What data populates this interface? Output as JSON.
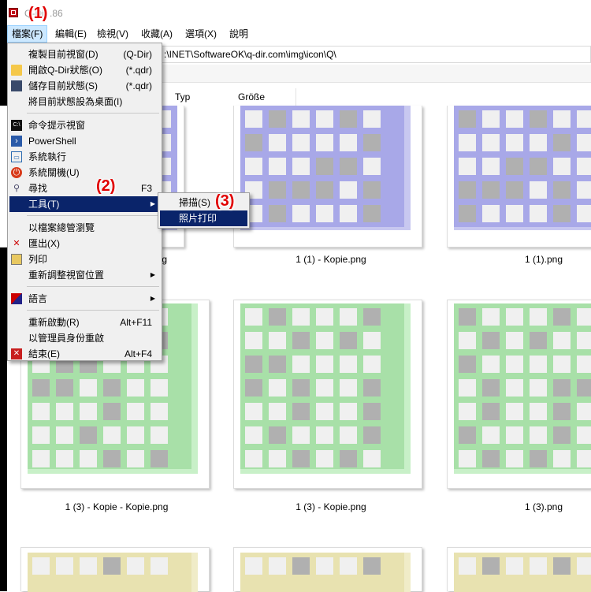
{
  "window": {
    "title_visible": "Q-Dir .86"
  },
  "menubar": [
    {
      "label": "檔案(F)"
    },
    {
      "label": "編輯(E)"
    },
    {
      "label": "檢視(V)"
    },
    {
      "label": "收藏(A)"
    },
    {
      "label": "選項(X)"
    },
    {
      "label": "說明"
    }
  ],
  "address": {
    "value": ":\\INET\\SoftwareOK\\q-dir.com\\img\\icon\\Q\\"
  },
  "columns": [
    "Typ",
    "Größe"
  ],
  "file_menu": {
    "items": [
      {
        "label": "複製目前視窗(D)",
        "shortcut": "(Q-Dir)",
        "icon": "none"
      },
      {
        "label": "開啟Q-Dir狀態(O)",
        "shortcut": "(*.qdr)",
        "icon": "folder-icon"
      },
      {
        "label": "儲存目前狀態(S)",
        "shortcut": "(*.qdr)",
        "icon": "floppy-icon"
      },
      {
        "label": "將目前狀態設為桌面(I)",
        "shortcut": "",
        "icon": "none"
      },
      {
        "label": "命令提示視窗",
        "shortcut": "",
        "icon": "cmd-icon"
      },
      {
        "label": "PowerShell",
        "shortcut": "",
        "icon": "powershell-icon"
      },
      {
        "label": "系統執行",
        "shortcut": "",
        "icon": "run-icon"
      },
      {
        "label": "系統關機(U)",
        "shortcut": "",
        "icon": "power-icon"
      },
      {
        "label": "尋找",
        "shortcut": "F3",
        "icon": "search-icon"
      },
      {
        "label": "工具(T)",
        "shortcut": "",
        "icon": "none"
      },
      {
        "label": "以檔案總管瀏覽",
        "shortcut": "",
        "icon": "none"
      },
      {
        "label": "匯出(X)",
        "shortcut": "",
        "icon": "export-icon"
      },
      {
        "label": "列印",
        "shortcut": "",
        "icon": "printer-icon"
      },
      {
        "label": "重新調整視窗位置",
        "shortcut": "",
        "icon": "none"
      },
      {
        "label": "語言",
        "shortcut": "",
        "icon": "language-icon"
      },
      {
        "label": "重新啟動(R)",
        "shortcut": "Alt+F11",
        "icon": "none"
      },
      {
        "label": "以管理員身份重啟",
        "shortcut": "",
        "icon": "none"
      },
      {
        "label": "結束(E)",
        "shortcut": "Alt+F4",
        "icon": "close-icon"
      }
    ]
  },
  "tools_submenu": {
    "items": [
      {
        "label": "掃描(S)"
      },
      {
        "label": "照片打印"
      }
    ]
  },
  "files": [
    {
      "name": "1 (1) - Kopie.png"
    },
    {
      "name": "1 (1).png"
    },
    {
      "name": "1 (3) - Kopie - Kopie.png"
    },
    {
      "name": "1 (3) - Kopie.png"
    },
    {
      "name": "1 (3).png"
    }
  ],
  "partial_caption": "ng",
  "annotations": [
    "(1)",
    "(2)",
    "(3)"
  ],
  "colors": {
    "menu_highlight": "#0a246a",
    "annotation": "#e00000",
    "thumb_blue": "#a8a8e8",
    "thumb_green": "#a8e0a8",
    "thumb_yellow": "#e8e2b0"
  }
}
